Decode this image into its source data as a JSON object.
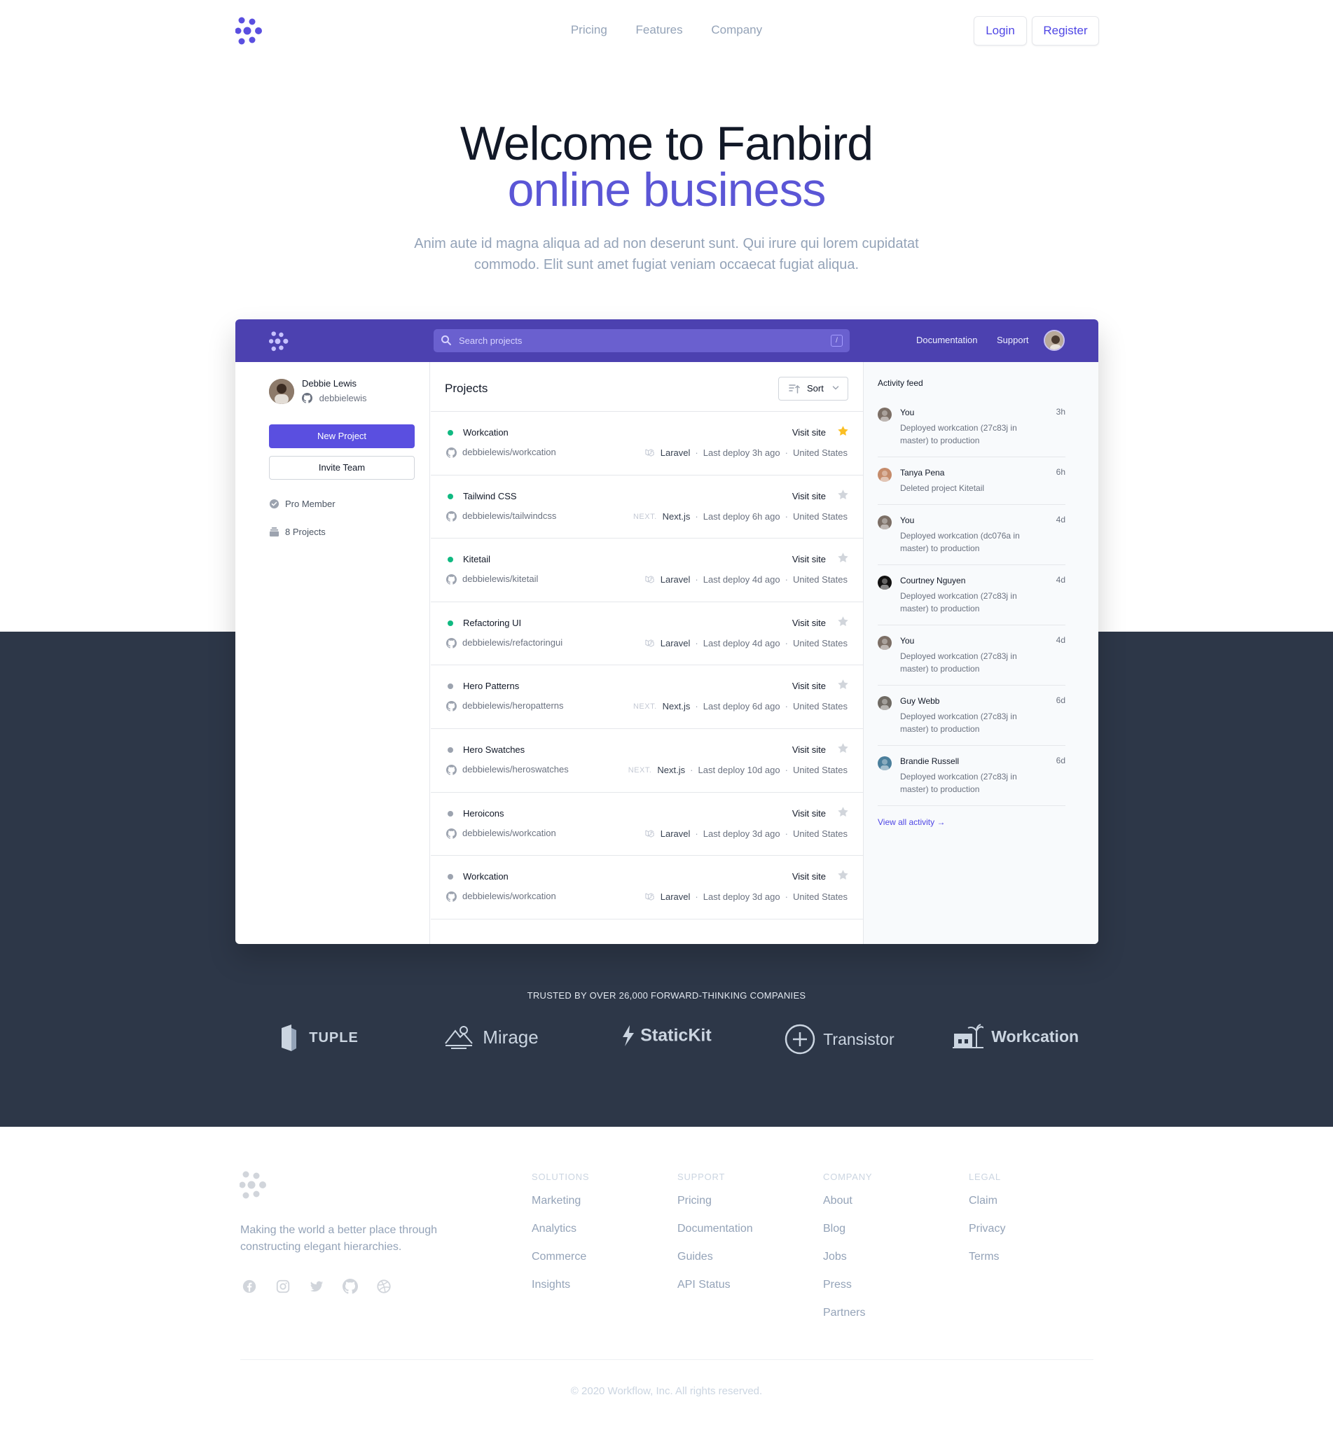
{
  "nav": {
    "links": [
      "Pricing",
      "Features",
      "Company"
    ],
    "login": "Login",
    "register": "Register"
  },
  "hero": {
    "title_line1": "Welcome to Fanbird",
    "title_line2": "online business",
    "subtitle": "Anim aute id magna aliqua ad ad non deserunt sunt. Qui irure qui lorem cupidatat commodo. Elit sunt amet fugiat veniam occaecat fugiat aliqua."
  },
  "app": {
    "search_placeholder": "Search projects",
    "search_shortcut": "/",
    "links": [
      "Documentation",
      "Support"
    ],
    "user": {
      "name": "Debbie Lewis",
      "handle": "debbielewis"
    },
    "new_project": "New Project",
    "invite_team": "Invite Team",
    "stats": {
      "membership": "Pro Member",
      "projects": "8 Projects"
    },
    "projects_title": "Projects",
    "sort_label": "Sort",
    "visit_label": "Visit site",
    "projects": [
      {
        "name": "Workcation",
        "repo": "debbielewis/workcation",
        "framework": "Laravel",
        "framework_icon": "laravel-icon",
        "deploy": "Last deploy 3h ago",
        "location": "United States",
        "active": true,
        "starred": true
      },
      {
        "name": "Tailwind CSS",
        "repo": "debbielewis/tailwindcss",
        "framework": "Next.js",
        "framework_icon": "nextjs-icon",
        "deploy": "Last deploy 6h ago",
        "location": "United States",
        "active": true,
        "starred": false
      },
      {
        "name": "Kitetail",
        "repo": "debbielewis/kitetail",
        "framework": "Laravel",
        "framework_icon": "laravel-icon",
        "deploy": "Last deploy 4d ago",
        "location": "United States",
        "active": true,
        "starred": false
      },
      {
        "name": "Refactoring UI",
        "repo": "debbielewis/refactoringui",
        "framework": "Laravel",
        "framework_icon": "laravel-icon",
        "deploy": "Last deploy 4d ago",
        "location": "United States",
        "active": true,
        "starred": false
      },
      {
        "name": "Hero Patterns",
        "repo": "debbielewis/heropatterns",
        "framework": "Next.js",
        "framework_icon": "nextjs-icon",
        "deploy": "Last deploy 6d ago",
        "location": "United States",
        "active": false,
        "starred": false
      },
      {
        "name": "Hero Swatches",
        "repo": "debbielewis/heroswatches",
        "framework": "Next.js",
        "framework_icon": "nextjs-icon",
        "deploy": "Last deploy 10d ago",
        "location": "United States",
        "active": false,
        "starred": false
      },
      {
        "name": "Heroicons",
        "repo": "debbielewis/workcation",
        "framework": "Laravel",
        "framework_icon": "laravel-icon",
        "deploy": "Last deploy 3d ago",
        "location": "United States",
        "active": false,
        "starred": false
      },
      {
        "name": "Workcation",
        "repo": "debbielewis/workcation",
        "framework": "Laravel",
        "framework_icon": "laravel-icon",
        "deploy": "Last deploy 3d ago",
        "location": "United States",
        "active": false,
        "starred": false
      }
    ],
    "activity_title": "Activity feed",
    "activity": [
      {
        "name": "You",
        "time": "3h",
        "text": "Deployed workcation (27c83j in master) to production",
        "avatar_color": "#7c6f66"
      },
      {
        "name": "Tanya Pena",
        "time": "6h",
        "text": "Deleted project Kitetail",
        "avatar_color": "#c58b6b"
      },
      {
        "name": "You",
        "time": "4d",
        "text": "Deployed workcation (dc076a in master) to production",
        "avatar_color": "#7c6f66"
      },
      {
        "name": "Courtney Nguyen",
        "time": "4d",
        "text": "Deployed workcation (27c83j in master) to production",
        "avatar_color": "#111111"
      },
      {
        "name": "You",
        "time": "4d",
        "text": "Deployed workcation (27c83j in master) to production",
        "avatar_color": "#7c6f66"
      },
      {
        "name": "Guy Webb",
        "time": "6d",
        "text": "Deployed workcation (27c83j in master) to production",
        "avatar_color": "#6f6a63"
      },
      {
        "name": "Brandie Russell",
        "time": "6d",
        "text": "Deployed workcation (27c83j in master) to production",
        "avatar_color": "#4b7f9c"
      }
    ],
    "view_all": "View all activity →"
  },
  "trusted": {
    "heading": "TRUSTED BY OVER 26,000 FORWARD-THINKING COMPANIES",
    "logos": [
      "TUPLE",
      "Mirage",
      "StaticKit",
      "Transistor",
      "Workcation"
    ]
  },
  "footer": {
    "tagline": "Making the world a better place through constructing elegant hierarchies.",
    "social": [
      "facebook-icon",
      "instagram-icon",
      "twitter-icon",
      "github-icon",
      "dribbble-icon"
    ],
    "columns": [
      {
        "heading": "SOLUTIONS",
        "items": [
          "Marketing",
          "Analytics",
          "Commerce",
          "Insights"
        ]
      },
      {
        "heading": "SUPPORT",
        "items": [
          "Pricing",
          "Documentation",
          "Guides",
          "API Status"
        ]
      },
      {
        "heading": "COMPANY",
        "items": [
          "About",
          "Blog",
          "Jobs",
          "Press",
          "Partners"
        ]
      },
      {
        "heading": "LEGAL",
        "items": [
          "Claim",
          "Privacy",
          "Terms"
        ]
      }
    ],
    "copyright": "© 2020 Workflow, Inc. All rights reserved."
  },
  "colors": {
    "brand": "#5a4fe0",
    "app_bar": "#4c41b0",
    "dark_band": "#2d3748",
    "active_dot": "#10b981",
    "inactive_dot": "#9ca3af",
    "star_on": "#fbbf24",
    "star_off": "#d1d5db"
  }
}
